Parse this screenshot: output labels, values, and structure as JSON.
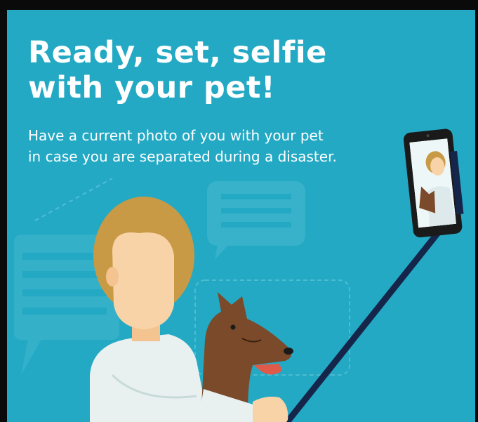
{
  "poster": {
    "headline_line1": "Ready, set, selfie",
    "headline_line2": "with your pet!",
    "subtext_line1": "Have a current photo of you with your pet",
    "subtext_line2": "in case you are separated during a disaster."
  },
  "colors": {
    "background": "#23a9c4",
    "frame": "#0a0a0a",
    "text": "#ffffff",
    "hair": "#c99a45",
    "skin": "#f8d3a8",
    "shirt": "#e8f0f0",
    "dog": "#7a4a2a",
    "stick": "#15264a"
  },
  "icons": [
    "chat-bubble-icon",
    "chat-bubble-icon",
    "phone-icon"
  ]
}
